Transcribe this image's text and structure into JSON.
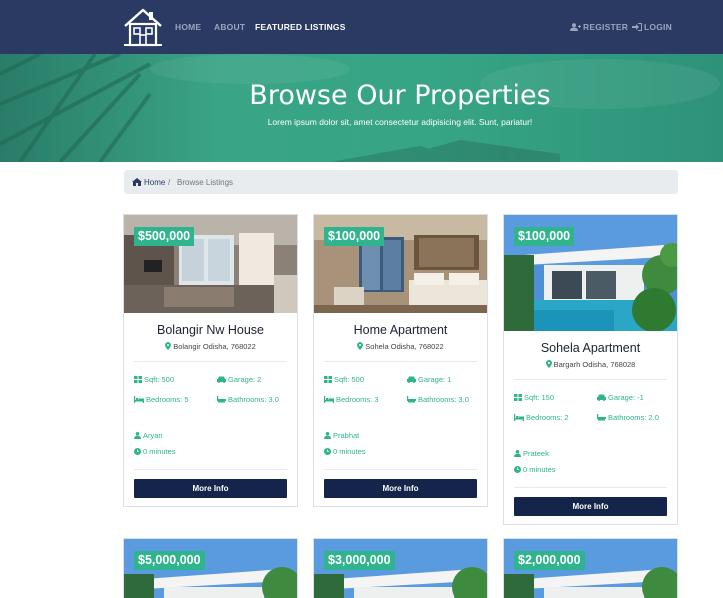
{
  "nav": {
    "links": [
      "HOME",
      "ABOUT",
      "FEATURED LISTINGS"
    ],
    "register": "REGISTER",
    "login": "LOGIN"
  },
  "hero": {
    "title": "Browse Our Properties",
    "subtitle": "Lorem ipsum dolor sit, amet consectetur adipisicing elit. Sunt, pariatur!"
  },
  "breadcrumb": {
    "home": "Home",
    "separator": "/",
    "current": "Browse Listings"
  },
  "listings": [
    {
      "price": "$500,000",
      "title": "Bolangir Nw House",
      "location": "Bolangir Odisha, 768022",
      "sqft": "Sqft: 500",
      "garage": "Garage: 2",
      "bedrooms": "Bedrooms: 5",
      "bathrooms": "Bathrooms: 3.0",
      "realtor": "Aryan",
      "time": "0 minutes",
      "button": "More Info",
      "image": "living-room-photo"
    },
    {
      "price": "$100,000",
      "title": "Home Apartment",
      "location": "Sohela Odisha, 768022",
      "sqft": "Sqft: 500",
      "garage": "Garage: 1",
      "bedrooms": "Bedrooms: 3",
      "bathrooms": "Bathrooms: 3.0",
      "realtor": "Prabhat",
      "time": "0 minutes",
      "button": "More Info",
      "image": "bedroom-photo"
    },
    {
      "price": "$100,000",
      "title": "Sohela Apartment",
      "location": "Bargarh Odisha, 768028",
      "sqft": "Sqft: 150",
      "garage": "Garage: -1",
      "bedrooms": "Bedrooms: 2",
      "bathrooms": "Bathrooms: 2.0",
      "realtor": "Prateek",
      "time": "0 minutes",
      "button": "More Info",
      "image": "villa-pool-photo"
    }
  ],
  "next_row_prices": [
    "$5,000,000",
    "$3,000,000",
    "$2,000,000"
  ],
  "colors": {
    "navbar": "#2a3a63",
    "accent": "#2fb48e",
    "button": "#14244a",
    "hero": "#3aa486"
  }
}
